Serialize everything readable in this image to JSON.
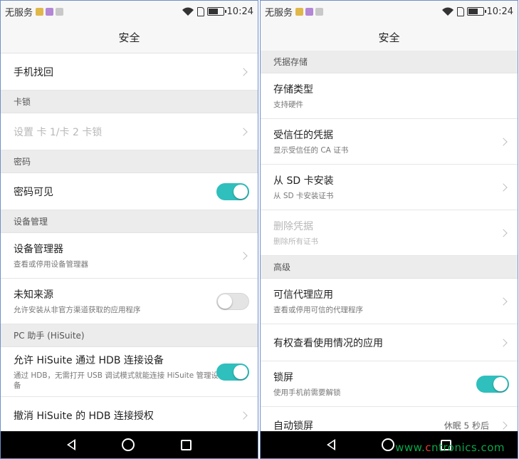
{
  "left": {
    "status": {
      "carrier": "无服务",
      "time": "10:24"
    },
    "title": "安全",
    "items": [
      {
        "kind": "row",
        "title": "手机找回",
        "chevron": true
      },
      {
        "kind": "section",
        "label": "卡锁"
      },
      {
        "kind": "row",
        "title": "设置 卡 1/卡 2 卡锁",
        "chevron": true,
        "disabled": true
      },
      {
        "kind": "section",
        "label": "密码"
      },
      {
        "kind": "row",
        "title": "密码可见",
        "toggle": true
      },
      {
        "kind": "section",
        "label": "设备管理"
      },
      {
        "kind": "row",
        "title": "设备管理器",
        "subtitle": "查看或停用设备管理器",
        "chevron": true
      },
      {
        "kind": "row",
        "title": "未知来源",
        "subtitle": "允许安装从非官方渠道获取的应用程序",
        "toggle": false
      },
      {
        "kind": "section",
        "label": "PC 助手 (HiSuite)"
      },
      {
        "kind": "row",
        "title": "允许 HiSuite 通过 HDB 连接设备",
        "subtitle": "通过 HDB，无需打开 USB 调试模式就能连接 HiSuite 管理设备",
        "toggle": true
      },
      {
        "kind": "row",
        "title": "撤消 HiSuite 的 HDB 连接授权",
        "chevron": true
      }
    ]
  },
  "right": {
    "status": {
      "carrier": "无服务",
      "time": "10:24"
    },
    "title": "安全",
    "items": [
      {
        "kind": "section",
        "label": "凭据存储"
      },
      {
        "kind": "row",
        "title": "存储类型",
        "subtitle": "支持硬件"
      },
      {
        "kind": "row",
        "title": "受信任的凭据",
        "subtitle": "显示受信任的 CA 证书",
        "chevron": true
      },
      {
        "kind": "row",
        "title": "从 SD 卡安装",
        "subtitle": "从 SD 卡安装证书",
        "chevron": true
      },
      {
        "kind": "row",
        "title": "删除凭据",
        "subtitle": "删除所有证书",
        "chevron": true,
        "disabled": true
      },
      {
        "kind": "section",
        "label": "高级"
      },
      {
        "kind": "row",
        "title": "可信代理应用",
        "subtitle": "查看或停用可信的代理程序",
        "chevron": true
      },
      {
        "kind": "row",
        "title": "有权查看使用情况的应用",
        "chevron": true
      },
      {
        "kind": "row",
        "title": "锁屏",
        "subtitle": "使用手机前需要解锁",
        "toggle": true
      },
      {
        "kind": "row",
        "title": "自动锁屏",
        "value": "休眠 5 秒后",
        "chevron": true
      }
    ]
  },
  "watermark": {
    "prefix": "www.",
    "c": "c",
    "rest": "ntronics.com"
  },
  "colors": {
    "toggle_on": "#2fbfbd",
    "section_bg": "#ececec",
    "frame": "#6f8fc9"
  }
}
